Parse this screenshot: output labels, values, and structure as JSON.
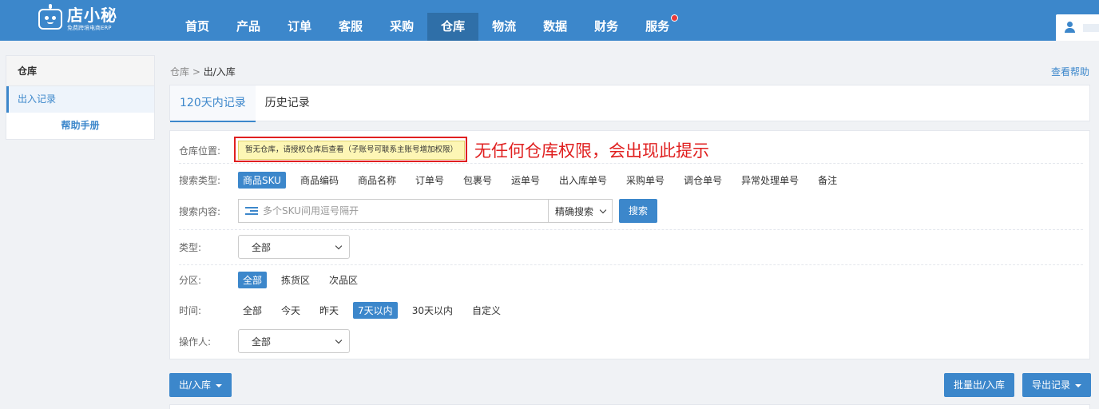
{
  "brand": {
    "name": "店小秘",
    "tagline": "免费跨境电商ERP"
  },
  "nav": {
    "items": [
      {
        "label": "首页"
      },
      {
        "label": "产品"
      },
      {
        "label": "订单"
      },
      {
        "label": "客服"
      },
      {
        "label": "采购"
      },
      {
        "label": "仓库",
        "active": true
      },
      {
        "label": "物流"
      },
      {
        "label": "数据"
      },
      {
        "label": "财务"
      },
      {
        "label": "服务",
        "badge_dot": true
      }
    ]
  },
  "sidebar": {
    "header": "仓库",
    "items": [
      {
        "label": "出入记录",
        "active": true
      }
    ],
    "help": "帮助手册"
  },
  "breadcrumb": {
    "parent": "仓库",
    "separator": ">",
    "current": "出/入库"
  },
  "help_link": "查看帮助",
  "tabs": [
    {
      "label": "120天内记录",
      "active": true
    },
    {
      "label": "历史记录"
    }
  ],
  "filter": {
    "warehouse": {
      "label": "仓库位置:",
      "warning": "暂无仓库，请授权仓库后查看（子账号可联系主账号增加权限）",
      "annotation": "无任何仓库权限，会出现此提示"
    },
    "search_type": {
      "label": "搜索类型:",
      "options": [
        "商品SKU",
        "商品编码",
        "商品名称",
        "订单号",
        "包裹号",
        "运单号",
        "出入库单号",
        "采购单号",
        "调仓单号",
        "异常处理单号",
        "备注"
      ],
      "selected": "商品SKU"
    },
    "search_content": {
      "label": "搜索内容:",
      "placeholder": "多个SKU间用逗号隔开",
      "mode": "精确搜索",
      "button": "搜索"
    },
    "type": {
      "label": "类型:",
      "value": "全部"
    },
    "zone": {
      "label": "分区:",
      "options": [
        "全部",
        "拣货区",
        "次品区"
      ],
      "selected": "全部"
    },
    "time": {
      "label": "时间:",
      "options": [
        "全部",
        "今天",
        "昨天",
        "7天以内",
        "30天以内",
        "自定义"
      ],
      "selected": "7天以内"
    },
    "operator": {
      "label": "操作人:",
      "value": "全部"
    }
  },
  "actions": {
    "in_out": "出/入库",
    "batch": "批量出/入库",
    "export": "导出记录"
  },
  "colors": {
    "primary": "#3c87cb",
    "topbar": "#3c87cb",
    "annotation_red": "#e02020",
    "warning_bg": "#fdf6b5"
  }
}
